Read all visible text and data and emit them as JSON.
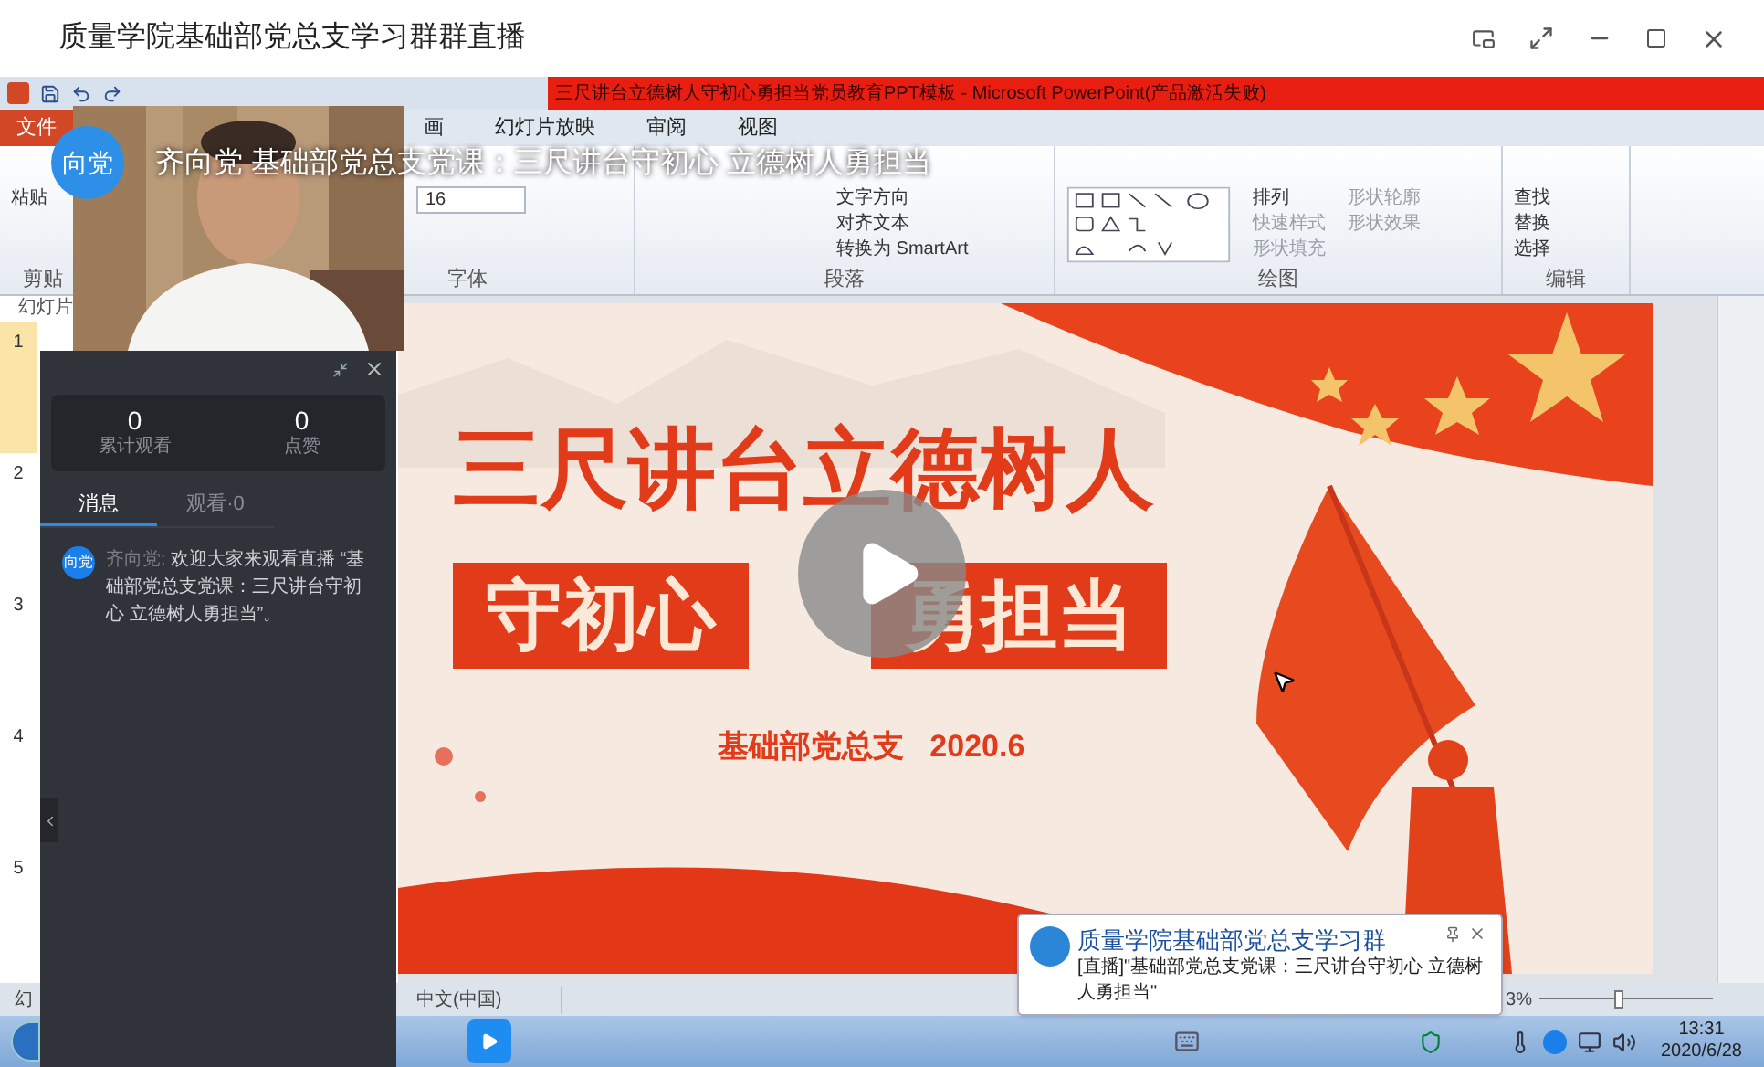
{
  "window": {
    "title": "质量学院基础部党总支学习群群直播"
  },
  "stream": {
    "avatar": "向党",
    "title": "齐向党 基础部党总支党课：三尺讲台守初心 立德树人勇担当"
  },
  "ppt": {
    "title": "三尺讲台立德树人守初心勇担当党员教育PPT模板 - Microsoft PowerPoint(产品激活失败)",
    "tabs": [
      {
        "label": "文件",
        "kind": "file"
      },
      {
        "label": "画",
        "kind": "tab"
      },
      {
        "label": "幻灯片放映",
        "kind": "tab"
      },
      {
        "label": "审阅",
        "kind": "tab"
      },
      {
        "label": "视图",
        "kind": "tab"
      }
    ],
    "groups": [
      {
        "label": "剪贴",
        "items": [
          "粘贴"
        ]
      },
      {
        "label": "字体",
        "items": [
          "16"
        ]
      },
      {
        "label": "段落",
        "items": [
          "文字方向",
          "对齐文本",
          "转换为 SmartArt"
        ]
      },
      {
        "label": "绘图",
        "items": [
          "排列",
          "快速样式",
          "形状填充",
          "形状轮廓",
          "形状效果"
        ]
      },
      {
        "label": "编辑",
        "items": [
          "查找",
          "替换",
          "选择"
        ]
      }
    ],
    "pane_label": "幻灯片",
    "thumbnails": [
      {
        "number": "1",
        "selected": true
      },
      {
        "number": "2",
        "selected": false
      },
      {
        "number": "3",
        "selected": false
      },
      {
        "number": "4",
        "selected": false
      },
      {
        "number": "5",
        "selected": false
      }
    ],
    "slide": {
      "title": "三尺讲台立德树人",
      "tags": [
        "守初心",
        "勇担当"
      ],
      "footer": "基础部党总支   2020.6"
    },
    "status": {
      "left": "幻",
      "language": "中文(中国)",
      "zoom": "3%",
      "zoom_slider": {
        "level": 0.45
      }
    }
  },
  "chat": {
    "stats": [
      {
        "value": "0",
        "label": "累计观看"
      },
      {
        "value": "0",
        "label": "点赞"
      }
    ],
    "tabs": [
      {
        "label": "消息",
        "selected": true
      },
      {
        "label": "观看·0",
        "selected": false
      }
    ],
    "messages": [
      {
        "avatar": "向党",
        "sender": "齐向党:",
        "text": "欢迎大家来观看直播 “基础部党总支党课：三尺讲台守初心 立德树人勇担当”。"
      }
    ]
  },
  "notification": {
    "title": "质量学院基础部党总支学习群",
    "body": "[直播]\"基础部党总支党课：三尺讲台守初心 立德树人勇担当\""
  },
  "taskbar": {
    "time": "13:31",
    "date": "2020/6/28"
  }
}
